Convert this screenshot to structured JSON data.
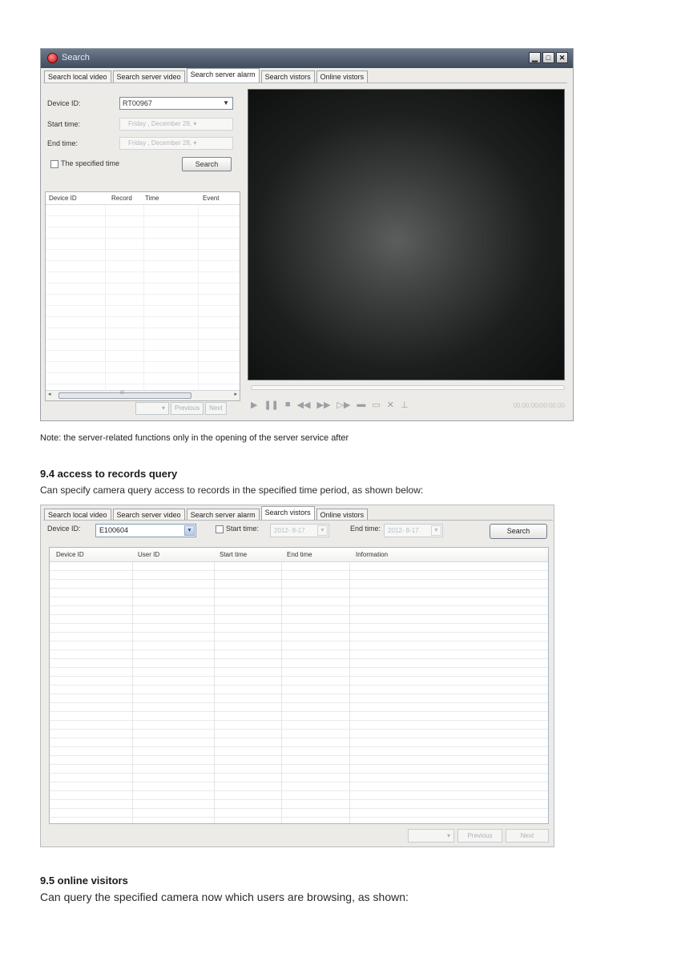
{
  "screenshot1": {
    "window_title": "Search",
    "window_buttons": [
      "▁",
      "□",
      "✕"
    ],
    "tabs": [
      "Search local video",
      "Search server video",
      "Search server alarm",
      "Search vistors",
      "Online vistors"
    ],
    "active_tab": "Search server alarm",
    "device_label": "Device ID:",
    "device_value": "RT00967",
    "start_label": "Start time:",
    "start_value": "Friday   , December  28,  ▾",
    "end_label": "End time:",
    "end_value": "Friday   , December  28,  ▾",
    "specified_label": "The specified time",
    "search_button": "Search",
    "columns": [
      "Device ID",
      "Record",
      "Time",
      "Event"
    ],
    "scroll_mark": "III",
    "pager": {
      "page": "",
      "previous": "Previous",
      "next": "Next"
    },
    "controls": [
      "▶",
      "❚❚",
      "■",
      "◀◀",
      "▶▶",
      "▷▶",
      "▬",
      "▭",
      "✕",
      "⊥"
    ],
    "time_readout": "00:00:00/00:00:00",
    "progress": 0
  },
  "note": "Note: the server-related functions only in the opening of the server service after",
  "section_94": {
    "heading": "9.4 access to records query",
    "text": "Can specify camera query access to records in the specified time period, as shown below:"
  },
  "screenshot2": {
    "tabs": [
      "Search local video",
      "Search server video",
      "Search server alarm",
      "Search vistors",
      "Online vistors"
    ],
    "active_tab": "Search vistors",
    "device_label": "Device ID:",
    "device_value": "E100604",
    "start_label": "Start time:",
    "start_value": "2012- 8-17",
    "end_label": "End time:",
    "end_value": "2012- 8-17",
    "search_button": "Search",
    "columns": [
      "Device ID",
      "User ID",
      "Start time",
      "End time",
      "Information"
    ],
    "pager": {
      "page": "",
      "previous": "Previous",
      "next": "Next"
    }
  },
  "section_95": {
    "heading": "9.5 online visitors",
    "text": "Can query the specified camera now which users are browsing, as shown:"
  },
  "colors": {
    "titlebar": "#4a5768",
    "accent": "#7f9db9",
    "background": "#ecebe7"
  }
}
